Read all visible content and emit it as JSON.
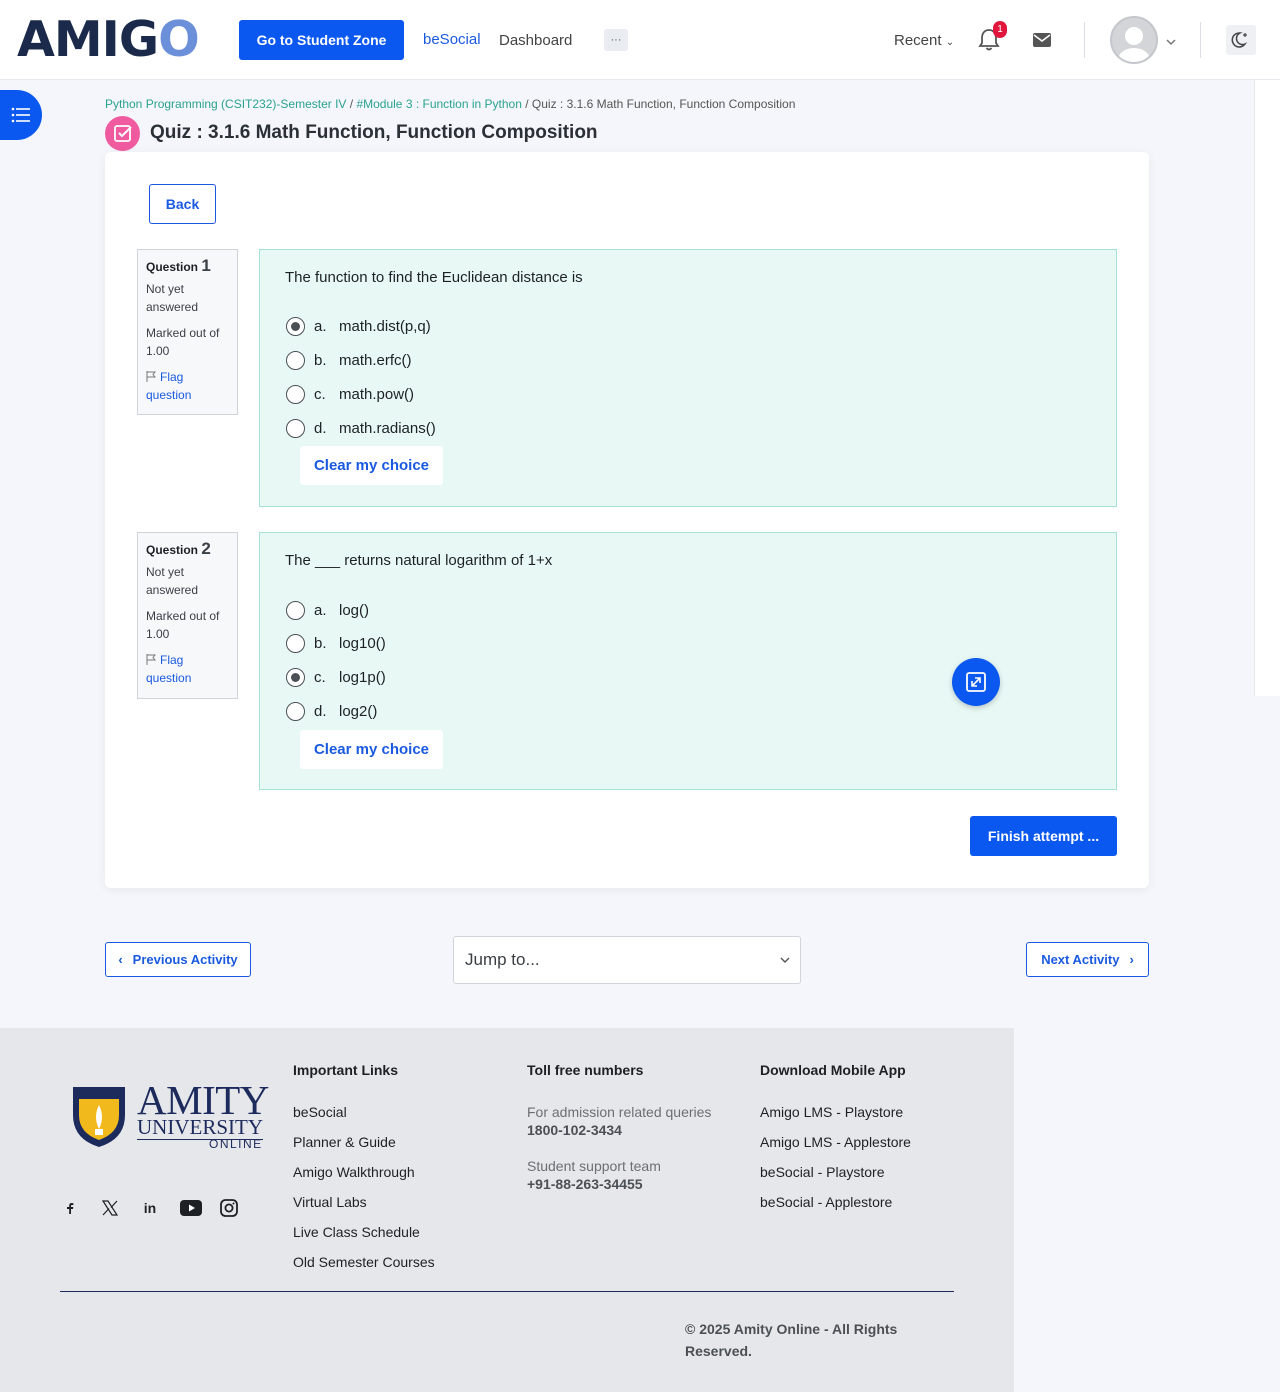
{
  "header": {
    "logo_text": "AMIGO",
    "student_zone_label": "Go to Student Zone",
    "nav_besocial": "beSocial",
    "nav_dashboard": "Dashboard",
    "more_label": "···",
    "recent_label": "Recent",
    "notification_count": "1"
  },
  "breadcrumb": {
    "course": "Python Programming (CSIT232)-Semester IV",
    "module": "#Module 3 : Function in Python",
    "current": "Quiz : 3.1.6 Math Function, Function Composition",
    "sep": "/"
  },
  "page_title": "Quiz : 3.1.6 Math Function, Function Composition",
  "back_label": "Back",
  "questions": [
    {
      "heading": "Question",
      "number": "1",
      "status": "Not yet answered",
      "marked": "Marked out of 1.00",
      "flag": "Flag question",
      "text": "The function to find the Euclidean distance is",
      "options": [
        {
          "letter": "a.",
          "text": "math.dist(p,q)",
          "selected": true
        },
        {
          "letter": "b.",
          "text": "math.erfc()",
          "selected": false
        },
        {
          "letter": "c.",
          "text": "math.pow()",
          "selected": false
        },
        {
          "letter": "d.",
          "text": "math.radians()",
          "selected": false
        }
      ],
      "clear_label": "Clear my choice"
    },
    {
      "heading": "Question",
      "number": "2",
      "status": "Not yet answered",
      "marked": "Marked out of 1.00",
      "flag": "Flag question",
      "text": "The ___ returns natural logarithm of 1+x",
      "options": [
        {
          "letter": "a.",
          "text": "log()",
          "selected": false
        },
        {
          "letter": "b.",
          "text": "log10()",
          "selected": false
        },
        {
          "letter": "c.",
          "text": "log1p()",
          "selected": true
        },
        {
          "letter": "d.",
          "text": "log2()",
          "selected": false
        }
      ],
      "clear_label": "Clear my choice"
    }
  ],
  "finish_label": "Finish attempt ...",
  "activity_nav": {
    "prev_label": "Previous Activity",
    "next_label": "Next Activity",
    "jump_placeholder": "Jump to..."
  },
  "footer": {
    "brand_word": "AMITY",
    "brand_university": "UNIVERSITY",
    "brand_online": "ONLINE",
    "important_links_title": "Important Links",
    "important_links": [
      "beSocial",
      "Planner & Guide",
      "Amigo Walkthrough",
      "Virtual Labs",
      "Live Class Schedule",
      "Old Semester Courses"
    ],
    "toll_title": "Toll free numbers",
    "admission_label": "For admission related queries",
    "admission_number": "1800-102-3434",
    "support_label": "Student support team",
    "support_number": "+91-88-263-34455",
    "app_title": "Download Mobile App",
    "app_links": [
      "Amigo LMS - Playstore",
      "Amigo LMS - Applestore",
      "beSocial - Playstore",
      "beSocial - Applestore"
    ],
    "copyright": "© 2025 Amity Online - All Rights Reserved."
  },
  "colors": {
    "primary": "#0a58f0",
    "question_bg": "#e7f8f5",
    "breadcrumb_link": "#2aa28e",
    "title_icon": "#f05ba0",
    "footer_bg": "#e6e7ea"
  }
}
